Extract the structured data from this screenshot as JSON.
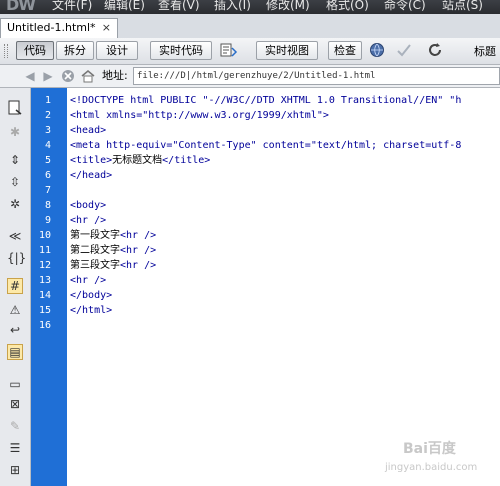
{
  "app": {
    "logo_text": "DW",
    "menus": [
      "文件(F)",
      "编辑(E)",
      "查看(V)",
      "插入(I)",
      "修改(M)",
      "格式(O)",
      "命令(C)",
      "站点(S)"
    ]
  },
  "document_tab": {
    "label": "Untitled-1.html*",
    "close_glyph": "×"
  },
  "toolbar": {
    "code_label": "代码",
    "split_label": "拆分",
    "design_label": "设计",
    "live_code_label": "实时代码",
    "live_view_label": "实时视图",
    "inspect_label": "检查",
    "title_label": "标题"
  },
  "address": {
    "label": "地址:",
    "value": "file:///D|/html/gerenzhuye/2/Untitled-1.html"
  },
  "editor": {
    "line_numbers": [
      "1",
      "2",
      "3",
      "4",
      "5",
      "6",
      "7",
      "8",
      "9",
      "10",
      "11",
      "12",
      "13",
      "14",
      "15",
      "16"
    ],
    "lines": {
      "l1": "<!DOCTYPE html PUBLIC \"-//W3C//DTD XHTML 1.0 Transitional//EN\" \"h",
      "l2": "<html xmlns=\"http://www.w3.org/1999/xhtml\">",
      "l3": "<head>",
      "l4": "<meta http-equiv=\"Content-Type\" content=\"text/html; charset=utf-8",
      "l5_open": "<title>",
      "l5_text": "无标题文档",
      "l5_close": "</title>",
      "l6": "</head>",
      "l7": "",
      "l8": "<body>",
      "l9": "<hr />",
      "l10_text": "第一段文字",
      "l10_tag": "<hr />",
      "l11_text": "第二段文字",
      "l11_tag": "<hr />",
      "l12_text": "第三段文字",
      "l12_tag": "<hr />",
      "l13": "<hr />",
      "l14": "</body>",
      "l15": "</html>",
      "l16": ""
    }
  },
  "watermark": {
    "brand": "Bai百度",
    "sub": "jingyan.baidu.com"
  },
  "colors": {
    "gutter": "#1f6fd6",
    "tag_text": "#000099",
    "menubar": "#2f3237"
  },
  "icons": [
    "back-arrow-icon",
    "forward-arrow-icon",
    "stop-icon",
    "home-icon",
    "refresh-icon",
    "globe-icon",
    "file-compare-icon",
    "title-icon"
  ]
}
